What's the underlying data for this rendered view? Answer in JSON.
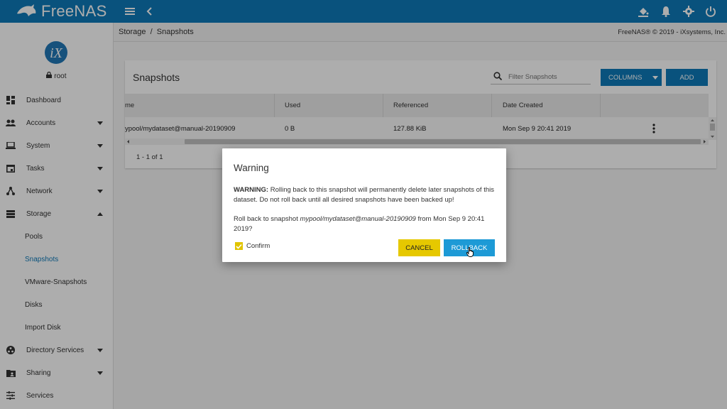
{
  "app": {
    "brand": "FreeNAS"
  },
  "sidebar": {
    "user": "root",
    "items": [
      {
        "label": "Dashboard",
        "icon": "dashboard-icon"
      },
      {
        "label": "Accounts",
        "icon": "accounts-icon"
      },
      {
        "label": "System",
        "icon": "laptop-icon"
      },
      {
        "label": "Tasks",
        "icon": "calendar-icon"
      },
      {
        "label": "Network",
        "icon": "network-icon"
      },
      {
        "label": "Storage",
        "icon": "storage-icon"
      },
      {
        "label": "Pools"
      },
      {
        "label": "Snapshots"
      },
      {
        "label": "VMware-Snapshots"
      },
      {
        "label": "Disks"
      },
      {
        "label": "Import Disk"
      },
      {
        "label": "Directory Services",
        "icon": "directory-services-icon"
      },
      {
        "label": "Sharing",
        "icon": "folder-share-icon"
      },
      {
        "label": "Services",
        "icon": "sliders-icon"
      }
    ],
    "active_item": "Snapshots"
  },
  "breadcrumb": {
    "text": "Storage  /  Snapshots"
  },
  "copyright": "FreeNAS® © 2019 - iXsystems, Inc.",
  "card": {
    "title": "Snapshots",
    "filter_placeholder": "Filter Snapshots",
    "columns_label": "COLUMNS",
    "add_label": "ADD",
    "columns": [
      "me",
      "Used",
      "Referenced",
      "Date Created"
    ],
    "rows": [
      {
        "name": "ypool/mydataset@manual-20190909",
        "used": "0 B",
        "referenced": "127.88 KiB",
        "date": "Mon Sep 9 20:41 2019"
      }
    ],
    "pager": "1 - 1 of 1"
  },
  "dialog": {
    "title": "Warning",
    "warning_bold": "WARNING:",
    "warning_text": " Rolling back to this snapshot will permanently delete later snapshots of this dataset. Do not roll back until all desired snapshots have been backed up!",
    "rollback_prefix": "Roll back to snapshot ",
    "rollback_snapshot": "mypool/mydataset@manual-20190909",
    "rollback_suffix": " from Mon Sep 9 20:41 2019?",
    "confirm_label": "Confirm",
    "confirm_checked": true,
    "cancel_label": "CANCEL",
    "rollback_label": "ROLLBACK"
  },
  "colors": {
    "primary": "#0e7ab8",
    "cancel": "#e6c800",
    "rollback": "#1d9ad6"
  }
}
